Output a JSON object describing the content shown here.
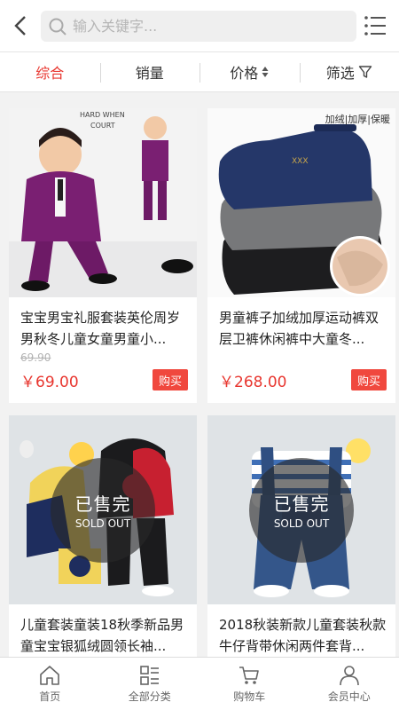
{
  "search": {
    "placeholder": "输入关键字..."
  },
  "filter": {
    "tabs": [
      "综合",
      "销量",
      "价格",
      "筛选"
    ]
  },
  "products": [
    {
      "title": "宝宝男宝礼服套装英伦周岁男秋冬儿童女童男童小...",
      "old_price": "69.90",
      "price": "￥69.00",
      "buy": "购买"
    },
    {
      "title": "男童裤子加绒加厚运动裤双层卫裤休闲裤中大童冬...",
      "price": "￥268.00",
      "buy": "购买",
      "image_tag": "加绒|加厚|保暖"
    },
    {
      "title": "儿童套装童装18秋季新品男童宝宝银狐绒圆领长袖...",
      "sold_cn": "已售完",
      "sold_en": "SOLD OUT"
    },
    {
      "title": "2018秋装新款儿童套装秋款牛仔背带休闲两件套背...",
      "sold_cn": "已售完",
      "sold_en": "SOLD OUT"
    }
  ],
  "bottom_nav": [
    "首页",
    "全部分类",
    "购物车",
    "会员中心"
  ],
  "colors": {
    "accent": "#e8362f",
    "buy_bg": "#f0483e"
  }
}
